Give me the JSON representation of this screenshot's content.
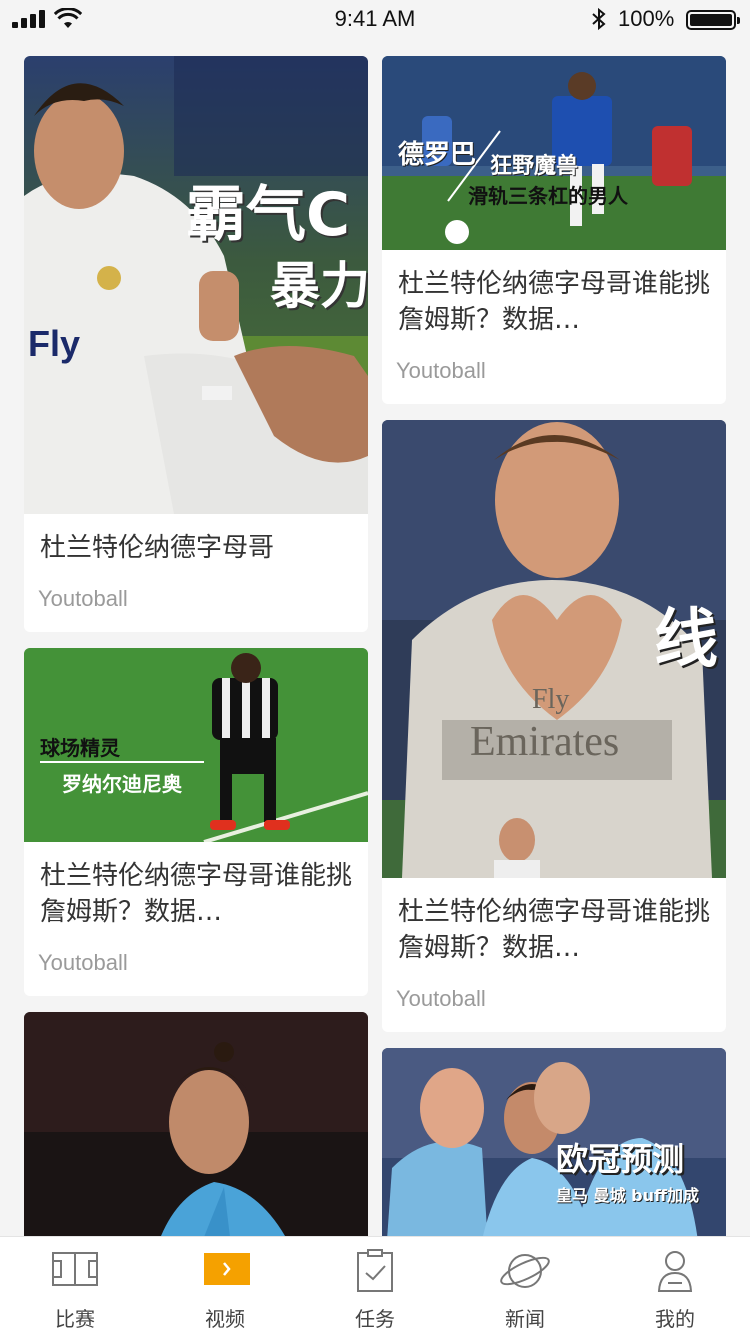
{
  "status_bar": {
    "time": "9:41 AM",
    "battery_percent": "100%"
  },
  "feed": {
    "cards": [
      {
        "title": "杜兰特伦纳德字母哥",
        "source": "Youtoball",
        "overlay": [
          "霸气C",
          "暴力"
        ]
      },
      {
        "title": "杜兰特伦纳德字母哥谁能挑詹姆斯？数据…",
        "source": "Youtoball",
        "overlay": [
          "德罗巴",
          "狂野魔兽",
          "滑轨三条杠的男人"
        ]
      },
      {
        "title": "杜兰特伦纳德字母哥谁能挑詹姆斯？数据…",
        "source": "Youtoball",
        "overlay": [
          "球场精灵",
          "罗纳尔迪尼奥"
        ]
      },
      {
        "title": "杜兰特伦纳德字母哥谁能挑詹姆斯？数据…",
        "source": "Youtoball",
        "overlay": [
          "线"
        ]
      },
      {
        "title": "",
        "source": "",
        "overlay": []
      },
      {
        "title": "",
        "source": "",
        "overlay": [
          "欧冠预测",
          "皇马 曼城 buff加成"
        ]
      }
    ]
  },
  "tabbar": {
    "accent": "#f5a100",
    "tabs": [
      {
        "label": "比赛",
        "icon": "pitch-icon",
        "active": false
      },
      {
        "label": "视频",
        "icon": "play-icon",
        "active": true
      },
      {
        "label": "任务",
        "icon": "clipboard-check-icon",
        "active": false
      },
      {
        "label": "新闻",
        "icon": "planet-icon",
        "active": false
      },
      {
        "label": "我的",
        "icon": "user-icon",
        "active": false
      }
    ]
  }
}
